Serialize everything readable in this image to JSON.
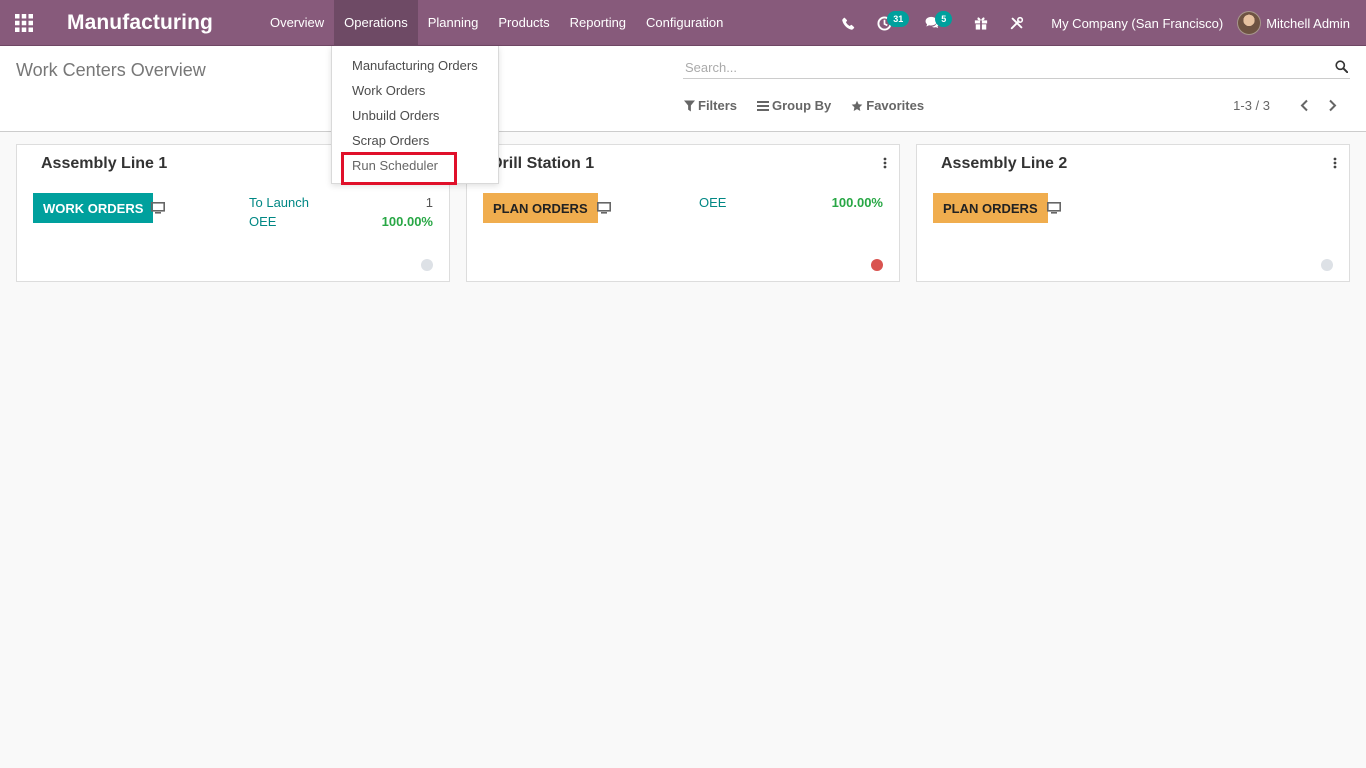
{
  "navbar": {
    "brand": "Manufacturing",
    "menu": [
      "Overview",
      "Operations",
      "Planning",
      "Products",
      "Reporting",
      "Configuration"
    ],
    "active_menu": "Operations",
    "activity_count": "31",
    "message_count": "5",
    "company": "My Company (San Francisco)",
    "user": "Mitchell Admin"
  },
  "control_panel": {
    "title": "Work Centers Overview",
    "search_placeholder": "Search...",
    "filters_label": "Filters",
    "group_by_label": "Group By",
    "favorites_label": "Favorites",
    "pager_value": "1-3 / 3"
  },
  "dropdown": {
    "items": [
      "Manufacturing Orders",
      "Work Orders",
      "Unbuild Orders",
      "Scrap Orders",
      "Run Scheduler"
    ],
    "highlighted": "Run Scheduler"
  },
  "cards": [
    {
      "title": "Assembly Line 1",
      "button": "WORK ORDERS",
      "stats": [
        {
          "label": "To Launch",
          "value": "1"
        },
        {
          "label": "OEE",
          "value": "100.00%"
        }
      ],
      "status_color": "#dde1e6"
    },
    {
      "title": "Drill Station 1",
      "button": "PLAN ORDERS",
      "stats": [
        {
          "label": "OEE",
          "value": "100.00%"
        }
      ],
      "status_color": "#d9534f"
    },
    {
      "title": "Assembly Line 2",
      "button": "PLAN ORDERS",
      "stats": [],
      "status_color": "#dde1e6"
    }
  ],
  "colors": {
    "brand": "#875a7b",
    "primary": "#00a09d",
    "warning": "#f0ad4e",
    "success": "#28a745",
    "highlight_border": "#e0102a"
  }
}
